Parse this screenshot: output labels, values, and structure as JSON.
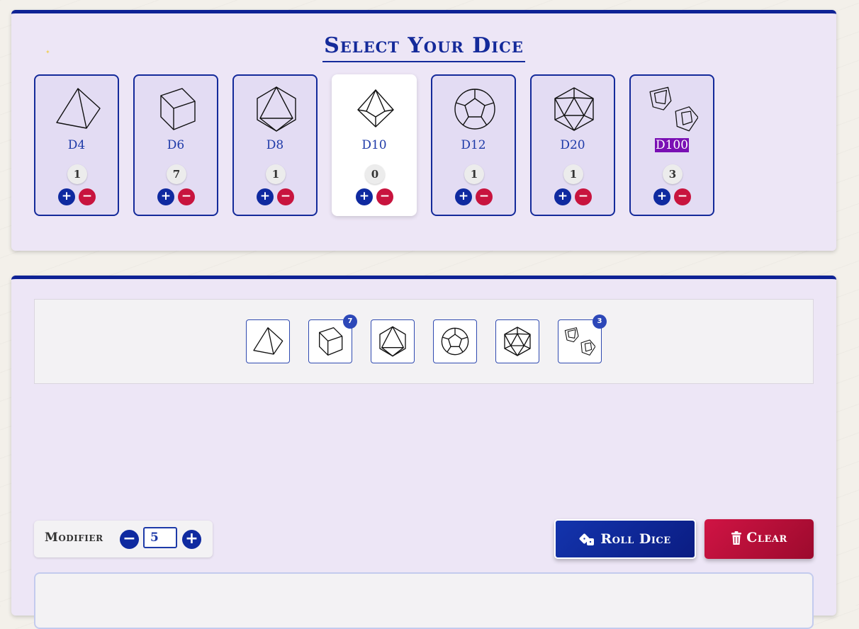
{
  "select_panel": {
    "title": "Select Your Dice",
    "dice": [
      {
        "label": "D4",
        "count": "1",
        "icon": "d4-icon",
        "selected": false
      },
      {
        "label": "D6",
        "count": "7",
        "icon": "d6-icon",
        "selected": false
      },
      {
        "label": "D8",
        "count": "1",
        "icon": "d8-icon",
        "selected": false
      },
      {
        "label": "D10",
        "count": "0",
        "icon": "d10-icon",
        "selected": true
      },
      {
        "label": "D12",
        "count": "1",
        "icon": "d12-icon",
        "selected": false
      },
      {
        "label": "D20",
        "count": "1",
        "icon": "d20-icon",
        "selected": false
      },
      {
        "label": "D100",
        "count": "3",
        "icon": "d100-icon",
        "selected": false,
        "label_highlighted": true
      }
    ],
    "plus_symbol": "+",
    "minus_symbol": "−"
  },
  "tray": {
    "dice": [
      {
        "icon": "d4-icon",
        "badge": ""
      },
      {
        "icon": "d6-icon",
        "badge": "7"
      },
      {
        "icon": "d8-icon",
        "badge": ""
      },
      {
        "icon": "d12-icon",
        "badge": ""
      },
      {
        "icon": "d20-icon",
        "badge": ""
      },
      {
        "icon": "d100-icon",
        "badge": "3"
      }
    ]
  },
  "modifier": {
    "label": "Modifier",
    "value": "5",
    "minus_symbol": "−",
    "plus_symbol": "+"
  },
  "actions": {
    "roll_label": "Roll Dice",
    "roll_icon": "dice-icon",
    "clear_label": "Clear",
    "clear_icon": "trash-icon"
  },
  "colors": {
    "accent_blue": "#142a9a",
    "danger_red": "#c8143e",
    "panel_bg": "#ede6f6",
    "highlight_purple": "#7a0fb4"
  }
}
